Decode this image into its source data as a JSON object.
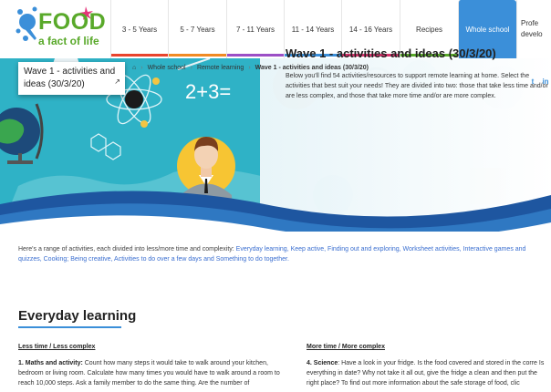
{
  "logo": {
    "brand": "FOOD",
    "tagline": "a fact of life"
  },
  "nav": {
    "items": [
      {
        "label": "3 - 5 Years",
        "color": "#e8442d"
      },
      {
        "label": "5 - 7 Years",
        "color": "#f08a24"
      },
      {
        "label": "7 - 11 Years",
        "color": "#9b4fc6"
      },
      {
        "label": "11 - 14 Years",
        "color": "#3b8fd9"
      },
      {
        "label": "14 - 16 Years",
        "color": "#d6336c"
      },
      {
        "label": "Recipes",
        "color": "#59a92a"
      },
      {
        "label": "Whole school",
        "color": "#3b8fd9"
      },
      {
        "label": "Profe",
        "label2": "develo",
        "color": "#ffffff"
      }
    ]
  },
  "breadcrumb": {
    "items": [
      "Whole school",
      "Remote learning"
    ],
    "current": "Wave 1 - activities and ideas (30/3/20)"
  },
  "title_card": {
    "title": "Wave 1 - activities and ideas (30/3/20)"
  },
  "hero": {
    "title": "Wave 1 - activities and ideas (30/3/20)",
    "description": "Below you'll find 54 activities/resources to support remote learning at home. Select the activities that best suit your needs! They are divided into two: those that take less time and/or are less complex, and those that take more time and/or are more complex.",
    "formula": "2+3=",
    "social": [
      "twitter-icon",
      "linkedin-icon"
    ]
  },
  "intro": {
    "text": "Here's a range of activities, each divided into less/more time and complexity: ",
    "links": "Everyday learning, Keep active, Finding out and exploring, Worksheet activities, Interactive games and quizzes, Cooking; Being creative, Activities to do over a few days and Something to do together."
  },
  "section": {
    "title": "Everyday learning",
    "left": {
      "head": "Less time / Less complex",
      "item_title": "1. Maths and activity:",
      "item_text": " Count how many steps it would take to walk around your kitchen, bedroom or living room. Calculate how many times you would have to walk around a room to reach 10,000 steps. Ask a family member to do the same thing. Are the number of"
    },
    "right": {
      "head": "More time / More complex",
      "item_title": "4. Science",
      "item_text": ": Have a look in your fridge. Is the food covered and stored in the corre Is everything in date?  Why not take it all out, give the fridge a clean and then put the right place? To find out more information about the safe storage of food, clic"
    }
  },
  "colors": {
    "accent": "#3b8fd9",
    "brand_green": "#59a92a",
    "hero_teal": "#2fb2c6",
    "wave_blue": "#1e56a0"
  }
}
